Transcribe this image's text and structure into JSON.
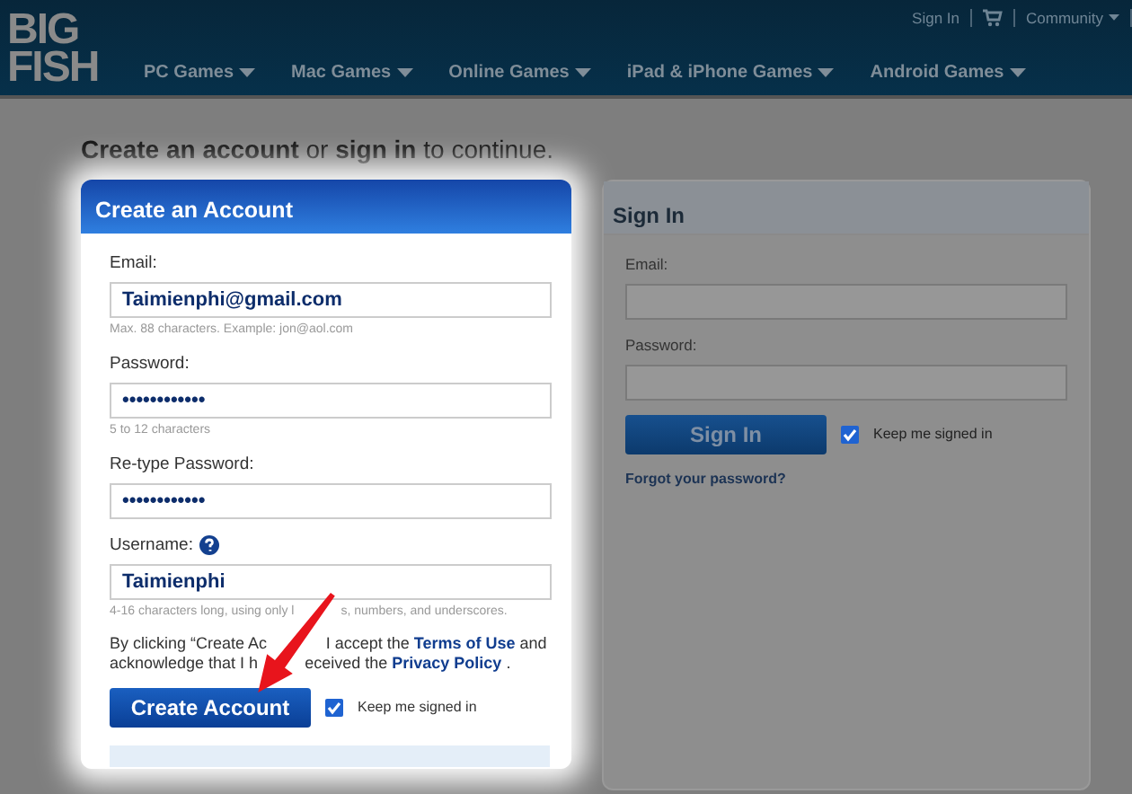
{
  "header": {
    "logo": [
      "BIG",
      "FISH"
    ],
    "top_links": [
      {
        "kind": "link",
        "label": "Sign In"
      },
      {
        "kind": "cart"
      },
      {
        "kind": "menu",
        "label": "Community"
      }
    ],
    "nav": [
      {
        "label": "PC Games"
      },
      {
        "label": "Mac Games"
      },
      {
        "label": "Online Games"
      },
      {
        "label": "iPad & iPhone Games"
      },
      {
        "label": "Android Games"
      }
    ]
  },
  "heading": "**Create an account** or **sign in** to continue.",
  "create_account": {
    "title": "Create an Account",
    "fields": [
      {
        "label": "Email:",
        "value": "Taimienphi@gmail.com",
        "hint": [
          "Max. 88 characters. Example: jon@aol.com"
        ],
        "help": false
      },
      {
        "label": "Password:",
        "value": "••••••••••••",
        "hint": [
          "5 to 12 characters"
        ],
        "help": false
      },
      {
        "label": "Re-type Password:",
        "value": "••••••••••••",
        "help": false
      },
      {
        "label": "Username:",
        "value": "Taimienphi",
        "hint": [
          "4-16 characters long, using only l",
          "s, numbers, and underscores."
        ],
        "help": true
      }
    ],
    "consent": [
      {
        "left": [
          {
            "kind": "text",
            "text": "By clicking “Create Ac"
          }
        ],
        "right": [
          {
            "kind": "text",
            "text": "I accept the"
          },
          {
            "kind": "link",
            "text": "Terms of Use"
          },
          {
            "kind": "text",
            "text": "and"
          }
        ]
      },
      {
        "left": [
          {
            "kind": "text",
            "text": "acknowledge that I h"
          }
        ],
        "right": [
          {
            "kind": "text",
            "text": "eceived the"
          },
          {
            "kind": "link",
            "text": "Privacy Policy"
          },
          {
            "kind": "text",
            "text": "."
          }
        ]
      }
    ],
    "button": "Create Account",
    "keep_signed_in": {
      "label": "Keep me signed in",
      "checked": true
    }
  },
  "sign_in": {
    "title": "Sign In",
    "fields": [
      {
        "label": "Email:"
      },
      {
        "label": "Password:"
      }
    ],
    "button": "Sign In",
    "keep_signed_in": {
      "label": "Keep me signed in",
      "checked": true
    },
    "forgot": "Forgot your password?"
  }
}
